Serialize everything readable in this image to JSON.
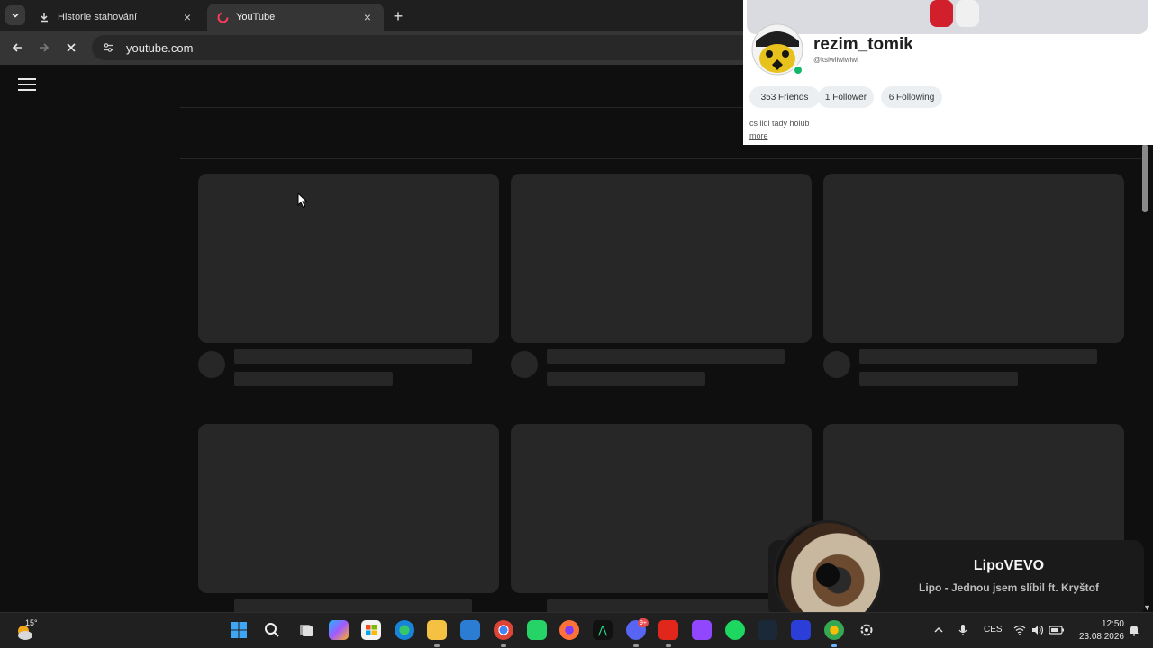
{
  "browser": {
    "tabs": [
      {
        "label": "Historie stahování",
        "icon": "download-icon",
        "active": false
      },
      {
        "label": "YouTube",
        "icon": "youtube-icon",
        "active": true
      }
    ],
    "new_tab": "+",
    "close_glyph": "×",
    "url": "youtube.com"
  },
  "profile_card": {
    "display_name": "rezim_tomik",
    "username": "@ksiwiiwiwiwi",
    "friends": "353 Friends",
    "followers": "1 Follower",
    "following": "6 Following",
    "bio": "cs lidi tady holub",
    "more_link": "more",
    "status_color": "#0fb86a"
  },
  "music_notification": {
    "artist": "LipoVEVO",
    "title": "Lipo - Jednou jsem slíbil ft. Kryštof"
  },
  "taskbar": {
    "weather_temp": "15°",
    "language": "CES",
    "time": "12:50",
    "date": "23.08.2026",
    "discord_badge": "9+"
  }
}
